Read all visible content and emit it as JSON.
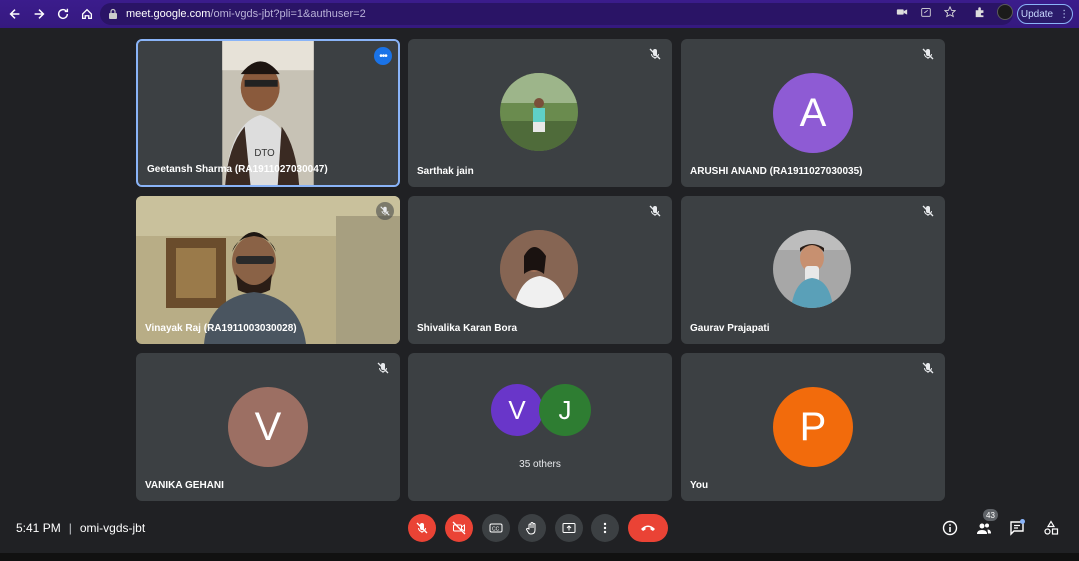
{
  "browser": {
    "url_host": "meet.google.com",
    "url_path": "/omi-vgds-jbt?pli=1&authuser=2",
    "update_label": "Update"
  },
  "tiles": [
    {
      "name": "Geetansh Sharma (RA1911027030047)",
      "muted": false,
      "active": true
    },
    {
      "name": "Sarthak jain",
      "muted": true
    },
    {
      "name": "ARUSHI ANAND (RA1911027030035)",
      "muted": true,
      "avatar_letter": "A",
      "avatar_color": "#8e5bd4"
    },
    {
      "name": "Vinayak Raj (RA1911003030028)",
      "muted": true
    },
    {
      "name": "Shivalika Karan Bora",
      "muted": true
    },
    {
      "name": "Gaurav Prajapati",
      "muted": true
    },
    {
      "name": "VANIKA GEHANI",
      "muted": true,
      "avatar_letter": "V",
      "avatar_color": "#9c6f63"
    },
    {
      "others_label": "35 others",
      "letters": [
        "V",
        "J"
      ],
      "colors": [
        "#6936c9",
        "#2e7d32"
      ]
    },
    {
      "name": "You",
      "muted": true,
      "avatar_letter": "P",
      "avatar_color": "#f26b0c"
    }
  ],
  "bottom": {
    "time": "5:41 PM",
    "meeting_code": "omi-vgds-jbt",
    "participants_count": "43"
  },
  "colors": {
    "red": "#ea4335",
    "tile_bg": "#3c4043",
    "page_bg": "#202124",
    "accent": "#8ab4f8"
  }
}
